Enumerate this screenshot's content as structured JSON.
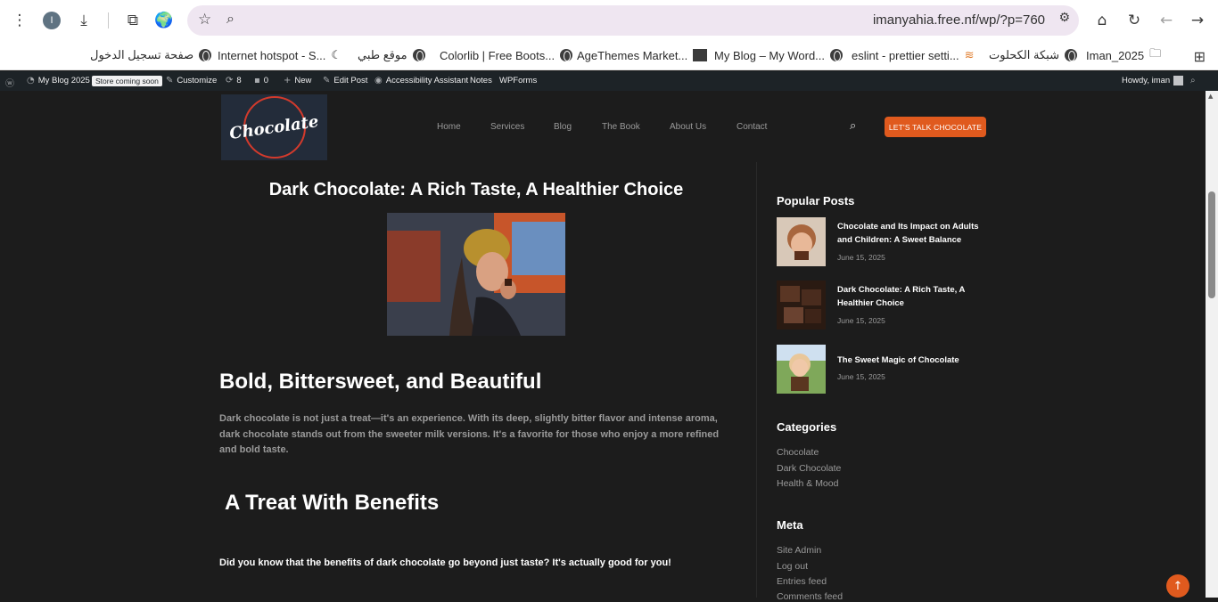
{
  "browser": {
    "url": "imanyahia.free.nf/wp/?p=760",
    "profile_initial": "I"
  },
  "bookmarks": [
    {
      "label": "صفحة تسجيل الدخول",
      "icon": "globe-icon"
    },
    {
      "label": "Internet hotspot - S...",
      "icon": "moon-icon"
    },
    {
      "label": "موقع طبي",
      "icon": "globe-icon"
    },
    {
      "label": "Colorlib | Free Boots...",
      "icon": "globe-icon"
    },
    {
      "label": "AgeThemes Market...",
      "icon": "agethemes-icon"
    },
    {
      "label": "My Blog – My Word...",
      "icon": "globe-icon"
    },
    {
      "label": "eslint - prettier setti...",
      "icon": "stack-icon"
    },
    {
      "label": "شبكة الكحلوت",
      "icon": "globe-icon"
    },
    {
      "label": "Iman_2025",
      "icon": "folder-icon"
    }
  ],
  "adminbar": {
    "site": "My Blog 2025",
    "store_badge": "Store coming soon",
    "customize": "Customize",
    "updates": "8",
    "comments": "0",
    "new": "New",
    "edit_post": "Edit Post",
    "accessibility": "Accessibility Assistant",
    "notes": "Notes",
    "wpforms": "WPForms",
    "howdy": "Howdy, iman"
  },
  "header": {
    "logo_text": "Chocolate",
    "nav": [
      "Home",
      "Services",
      "Blog",
      "The Book",
      "About Us",
      "Contact"
    ],
    "cta": "LET'S TALK CHOCOLATE"
  },
  "post": {
    "title": "Dark Chocolate: A Rich Taste, A Healthier Choice",
    "h2_1": "Bold, Bittersweet, and Beautiful",
    "paragraph": "Dark chocolate is not just a treat—it's an experience. With its deep, slightly bitter flavor and intense aroma, dark chocolate stands out from the sweeter milk versions. It's a favorite for those who enjoy a more refined and bold taste.",
    "h2_2": "A Treat With Benefits",
    "lead": "Did you know that the benefits of dark chocolate go beyond just taste? It's actually good for you!"
  },
  "sidebar": {
    "popular_heading": "Popular Posts",
    "popular": [
      {
        "title": "Chocolate and Its Impact on Adults and Children: A Sweet Balance",
        "date": "June 15, 2025"
      },
      {
        "title": "Dark Chocolate: A Rich Taste, A Healthier Choice",
        "date": "June 15, 2025"
      },
      {
        "title": "The Sweet Magic of Chocolate",
        "date": "June 15, 2025"
      }
    ],
    "categories_heading": "Categories",
    "categories": [
      "Chocolate",
      "Dark Chocolate",
      "Health & Mood"
    ],
    "meta_heading": "Meta",
    "meta": [
      "Site Admin",
      "Log out",
      "Entries feed",
      "Comments feed"
    ]
  }
}
